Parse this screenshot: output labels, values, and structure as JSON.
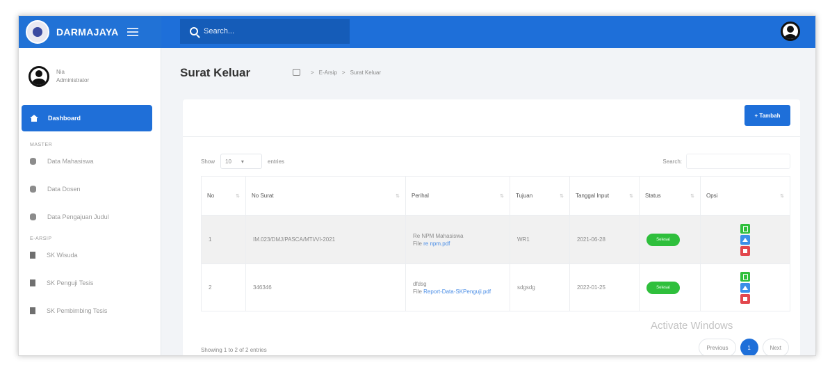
{
  "topbar": {
    "brand": "DARMAJAYA",
    "search_placeholder": "Search..."
  },
  "sidebar": {
    "user": {
      "name": "Nia",
      "role": "Administrator"
    },
    "active_item": "Dashboard",
    "sections": [
      {
        "label": "MASTER",
        "items": [
          "Data Mahasiswa",
          "Data Dosen",
          "Data Pengajuan Judul"
        ]
      },
      {
        "label": "E-ARSIP",
        "items": [
          "SK Wisuda",
          "SK Penguji Tesis",
          "SK Pembimbing Tesis"
        ]
      }
    ]
  },
  "page": {
    "title": "Surat Keluar",
    "breadcrumb": [
      "E-Arsip",
      "Surat Keluar"
    ]
  },
  "card": {
    "add_button": "+ Tambah",
    "show_label": "Show",
    "entries_value": "10",
    "entries_label": "entries",
    "search_label": "Search:"
  },
  "table": {
    "headers": [
      "No",
      "No Surat",
      "Perihal",
      "Tujuan",
      "Tanggal Input",
      "Status",
      "Opsi"
    ],
    "rows": [
      {
        "no": "1",
        "no_surat": "IM.023/DMJ/PASCA/MTI/VI-2021",
        "perihal": "Re NPM Mahasiswa",
        "file_prefix": "File",
        "file": "re npm.pdf",
        "tujuan": "WR1",
        "tanggal": "2021-06-28",
        "status": "Selesai"
      },
      {
        "no": "2",
        "no_surat": "346346",
        "perihal": "dfdsg",
        "file_prefix": "File",
        "file": "Report-Data-SKPenguji.pdf",
        "tujuan": "sdgsdg",
        "tanggal": "2022-01-25",
        "status": "Selesai"
      }
    ]
  },
  "footer": {
    "info": "Showing 1 to 2 of 2 entries",
    "prev": "Previous",
    "current_page": "1",
    "next": "Next"
  },
  "watermark": "Activate Windows",
  "colors": {
    "primary": "#1e6fd9",
    "success": "#2fbf3c",
    "danger": "#e2474d",
    "info": "#3b8fe8"
  }
}
